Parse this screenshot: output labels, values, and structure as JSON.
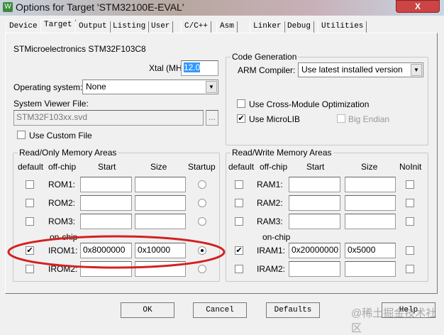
{
  "window": {
    "title": "Options for Target 'STM32100E-EVAL'",
    "close": "X",
    "icon": "W"
  },
  "tabs": [
    "Device",
    "Target",
    "Output",
    "Listing",
    "User",
    "C/C++",
    "Asm",
    "Linker",
    "Debug",
    "Utilities"
  ],
  "device_name": "STMicroelectronics STM32F103C8",
  "xtal": {
    "label": "Xtal (MHz):",
    "value": "12.0"
  },
  "os": {
    "label": "Operating system:",
    "value": "None"
  },
  "svf": {
    "label": "System Viewer File:",
    "value": "STM32F103xx.svd",
    "browse": "...",
    "custom_label": "Use Custom File"
  },
  "codegen": {
    "title": "Code Generation",
    "compiler_label": "ARM Compiler:",
    "compiler_value": "Use latest installed version",
    "cross_module": "Use Cross-Module Optimization",
    "microlib": "Use MicroLIB",
    "big_endian": "Big Endian"
  },
  "rom": {
    "title": "Read/Only Memory Areas",
    "headers": [
      "default",
      "off-chip",
      "Start",
      "Size",
      "Startup"
    ],
    "onchip": "on-chip",
    "rows": [
      {
        "label": "ROM1:",
        "start": "",
        "size": "",
        "default": false,
        "startup": false
      },
      {
        "label": "ROM2:",
        "start": "",
        "size": "",
        "default": false,
        "startup": false
      },
      {
        "label": "ROM3:",
        "start": "",
        "size": "",
        "default": false,
        "startup": false
      },
      {
        "label": "IROM1:",
        "start": "0x8000000",
        "size": "0x10000",
        "default": true,
        "startup": true
      },
      {
        "label": "IROM2:",
        "start": "",
        "size": "",
        "default": false,
        "startup": false
      }
    ]
  },
  "ram": {
    "title": "Read/Write Memory Areas",
    "headers": [
      "default",
      "off-chip",
      "Start",
      "Size",
      "NoInit"
    ],
    "onchip": "on-chip",
    "rows": [
      {
        "label": "RAM1:",
        "start": "",
        "size": "",
        "default": false,
        "noinit": false
      },
      {
        "label": "RAM2:",
        "start": "",
        "size": "",
        "default": false,
        "noinit": false
      },
      {
        "label": "RAM3:",
        "start": "",
        "size": "",
        "default": false,
        "noinit": false
      },
      {
        "label": "IRAM1:",
        "start": "0x20000000",
        "size": "0x5000",
        "default": true,
        "noinit": false
      },
      {
        "label": "IRAM2:",
        "start": "",
        "size": "",
        "default": false,
        "noinit": false
      }
    ]
  },
  "buttons": {
    "ok": "OK",
    "cancel": "Cancel",
    "defaults": "Defaults",
    "help": "Help"
  },
  "watermark": "@稀土掘金技术社区",
  "annotation_color": "#d42020"
}
